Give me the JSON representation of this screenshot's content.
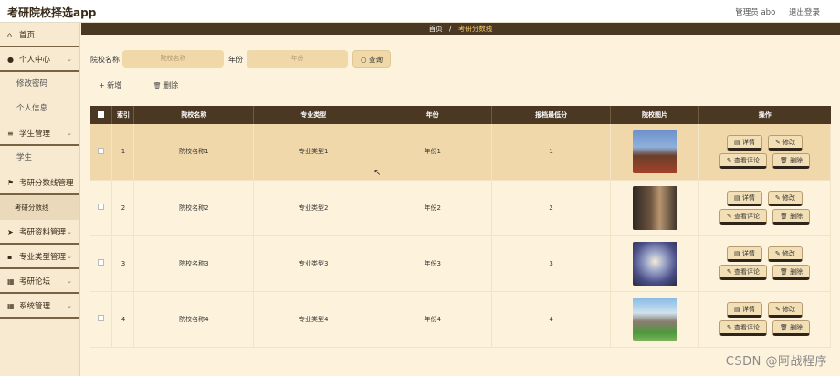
{
  "app": {
    "title": "考研院校择选app"
  },
  "header": {
    "admin": "管理员 abo",
    "logout": "退出登录"
  },
  "sidebar": {
    "items": [
      {
        "label": "首页",
        "icon": "home-icon",
        "type": "parent",
        "glyph": "⌂",
        "chev": ""
      },
      {
        "label": "个人中心",
        "icon": "user-icon",
        "type": "parent",
        "glyph": "●",
        "chev": "⌄"
      },
      {
        "label": "修改密码",
        "type": "sub"
      },
      {
        "label": "个人信息",
        "type": "sub"
      },
      {
        "label": "学生管理",
        "icon": "list-icon",
        "type": "parent",
        "glyph": "≡",
        "chev": "⌄"
      },
      {
        "label": "学生",
        "type": "sub"
      },
      {
        "label": "考研分数线管理",
        "icon": "flag-icon",
        "type": "parent",
        "glyph": "⚑",
        "chev": "⌄"
      },
      {
        "label": "考研分数线",
        "type": "active-sub"
      },
      {
        "label": "考研资料管理",
        "icon": "send-icon",
        "type": "parent",
        "glyph": "➤",
        "chev": "⌄"
      },
      {
        "label": "专业类型管理",
        "icon": "book-icon",
        "type": "parent",
        "glyph": "▪",
        "chev": "⌄"
      },
      {
        "label": "考研论坛",
        "icon": "grid-icon",
        "type": "parent",
        "glyph": "▦",
        "chev": "⌄"
      },
      {
        "label": "系统管理",
        "icon": "grid-icon",
        "type": "parent",
        "glyph": "▦",
        "chev": "⌄"
      }
    ]
  },
  "breadcrumb": {
    "home": "首页",
    "separator": "/",
    "current": "考研分数线"
  },
  "search": {
    "school_label": "院校名称",
    "school_placeholder": "院校名称",
    "year_label": "年份",
    "year_placeholder": "年份",
    "button": "查询",
    "button_icon": "○"
  },
  "actions": {
    "add_icon": "+",
    "add": "新增",
    "delete_icon": "🗑",
    "delete": "删除"
  },
  "table": {
    "headers": [
      "索引",
      "院校名称",
      "专业类型",
      "年份",
      "报档最低分",
      "院校图片",
      "操作"
    ],
    "rows": [
      {
        "index": "1",
        "school": "院校名称1",
        "major": "专业类型1",
        "year": "年份1",
        "score": "1"
      },
      {
        "index": "2",
        "school": "院校名称2",
        "major": "专业类型2",
        "year": "年份2",
        "score": "2"
      },
      {
        "index": "3",
        "school": "院校名称3",
        "major": "专业类型3",
        "year": "年份3",
        "score": "3"
      },
      {
        "index": "4",
        "school": "院校名称4",
        "major": "专业类型4",
        "year": "年份4",
        "score": "4"
      }
    ],
    "ops": {
      "detail": "详情",
      "edit": "修改",
      "review": "查看评论",
      "delete": "删除"
    },
    "op_icons": {
      "detail": "▤",
      "edit": "✎",
      "review": "✎",
      "delete": "🗑"
    }
  },
  "watermark": "CSDN @阿战程序"
}
